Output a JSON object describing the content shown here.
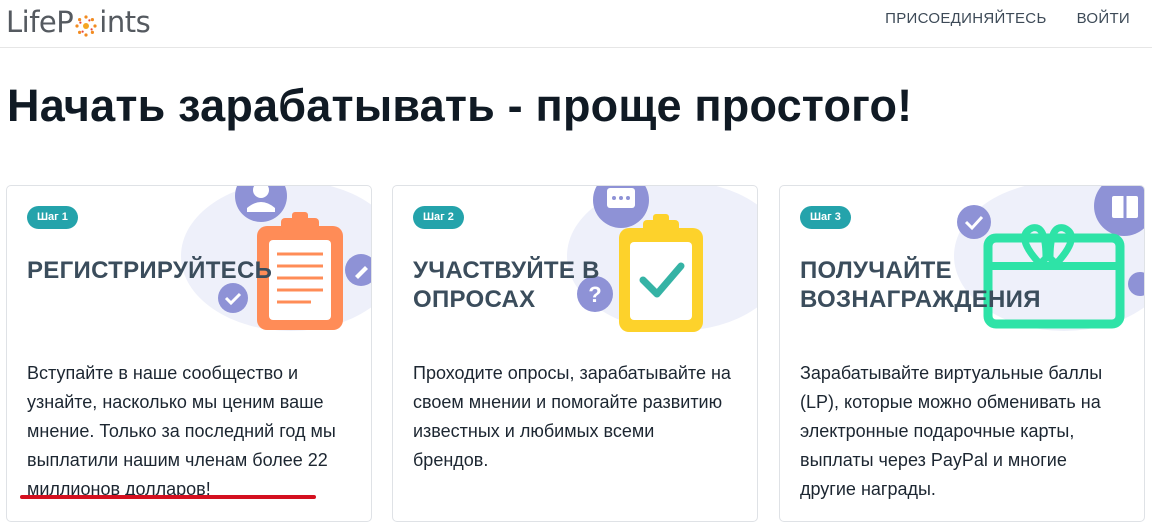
{
  "header": {
    "logo_left": "LifeP",
    "logo_right": "ints",
    "nav": {
      "join": "ПРИСОЕДИНЯЙТЕСЬ",
      "login": "ВОЙТИ"
    }
  },
  "page_title": "Начать зарабатывать - проще простого!",
  "steps": [
    {
      "badge": "Шаг 1",
      "title": "РЕГИСТРИРУЙТЕСЬ",
      "text_main": "Вступайте в наше сообщество и узнайте, насколько мы ценим ваше мнение. Только за последний год мы выплатили нашим членам",
      "text_highlight": "более 22 миллионов долларов!",
      "icon_color": "#ff8c57"
    },
    {
      "badge": "Шаг 2",
      "title": "УЧАСТВУЙТЕ В ОПРОСАХ",
      "text_main": "Проходите опросы, зарабатывайте на своем мнении и помогайте развитию известных и любимых всеми брендов.",
      "icon_color": "#fdd22b"
    },
    {
      "badge": "Шаг 3",
      "title": "ПОЛУЧАЙТЕ ВОЗНАГРАЖДЕНИЯ",
      "text_main": "Зарабатывайте виртуальные баллы (LP), которые можно обменивать на электронные подарочные карты, выплаты через PayPal и многие другие награды.",
      "icon_color": "#2ee3a7"
    }
  ],
  "colors": {
    "badge": "#24a3ab",
    "accent_purple": "#8e92d6",
    "underline": "#d4101f"
  }
}
